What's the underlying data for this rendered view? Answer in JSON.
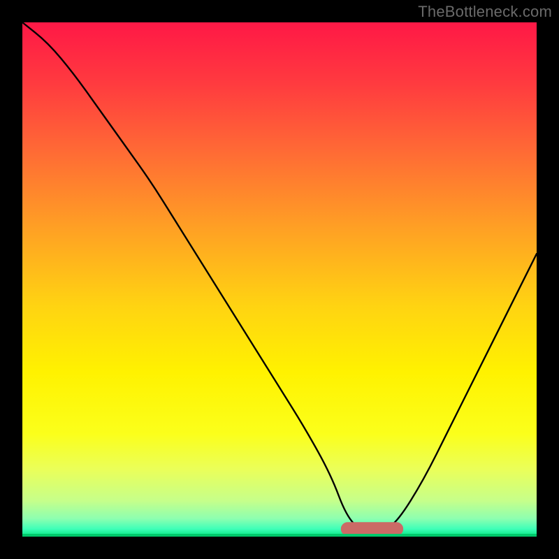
{
  "watermark": "TheBottleneck.com",
  "colors": {
    "frame": "#000000",
    "curve": "#000000",
    "marker_fill": "#cb6a66",
    "marker_stroke": "#cb6a66",
    "gradient_stops": [
      {
        "offset": 0.0,
        "color": "#ff1846"
      },
      {
        "offset": 0.12,
        "color": "#ff3b3f"
      },
      {
        "offset": 0.25,
        "color": "#ff6a35"
      },
      {
        "offset": 0.4,
        "color": "#ffa024"
      },
      {
        "offset": 0.55,
        "color": "#ffd312"
      },
      {
        "offset": 0.68,
        "color": "#fff200"
      },
      {
        "offset": 0.8,
        "color": "#fbff1b"
      },
      {
        "offset": 0.87,
        "color": "#eaff5a"
      },
      {
        "offset": 0.93,
        "color": "#c6ff8a"
      },
      {
        "offset": 0.965,
        "color": "#8dffb0"
      },
      {
        "offset": 0.985,
        "color": "#3fffb8"
      },
      {
        "offset": 1.0,
        "color": "#00e57d"
      }
    ]
  },
  "chart_data": {
    "type": "line",
    "title": "",
    "xlabel": "",
    "ylabel": "",
    "xlim": [
      0,
      100
    ],
    "ylim": [
      0,
      100
    ],
    "note": "V-shaped bottleneck curve. Steep fall from top-left wall, flat bottom segment near ~63-73 on x, rise toward right; optimum marked by salmon bar at bottom.",
    "series": [
      {
        "name": "bottleneck-curve",
        "x": [
          0,
          5,
          10,
          15,
          20,
          25,
          30,
          35,
          40,
          45,
          50,
          55,
          60,
          63,
          66,
          70,
          73,
          78,
          83,
          88,
          93,
          100
        ],
        "y": [
          100,
          96,
          90,
          83,
          76,
          69,
          61,
          53,
          45,
          37,
          29,
          21,
          12,
          4,
          1,
          1,
          3,
          11,
          21,
          31,
          41,
          55
        ]
      }
    ],
    "marker": {
      "name": "optimal-range",
      "x_start": 62,
      "x_end": 74,
      "y": 1.5,
      "thickness": 2.5
    }
  }
}
